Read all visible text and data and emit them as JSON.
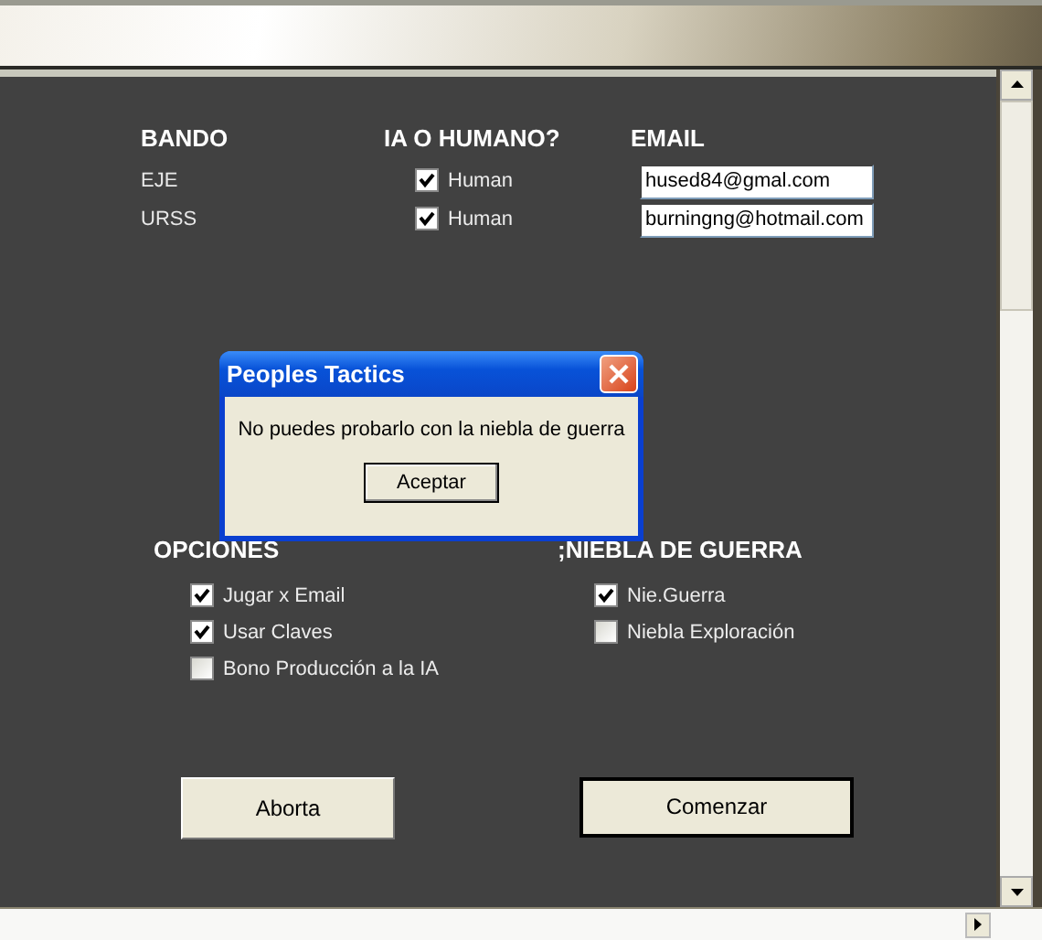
{
  "players_header": [
    "BANDO",
    "IA O HUMANO?",
    "EMAIL"
  ],
  "players": [
    {
      "side": "EJE",
      "human_label": "Human",
      "checked": true,
      "email": "hused84@gmal.com"
    },
    {
      "side": "URSS",
      "human_label": "Human",
      "checked": true,
      "email": "burningng@hotmail.com"
    }
  ],
  "options": {
    "title": "OPCIONES",
    "items": [
      {
        "label": "Jugar x Email",
        "checked": true
      },
      {
        "label": "Usar Claves",
        "checked": true
      },
      {
        "label": "Bono Producción a la IA",
        "checked": false
      }
    ]
  },
  "fog": {
    "title": ";NIEBLA DE GUERRA",
    "items": [
      {
        "label": "Nie.Guerra",
        "checked": true
      },
      {
        "label": "Niebla Exploración",
        "checked": false
      }
    ]
  },
  "buttons": [
    {
      "label": "Aborta",
      "default": false
    },
    {
      "label": "Comenzar",
      "default": true
    }
  ],
  "dialog": {
    "title": "Peoples Tactics",
    "message": "No puedes probarlo con la niebla de guerra",
    "button": "Aceptar"
  }
}
